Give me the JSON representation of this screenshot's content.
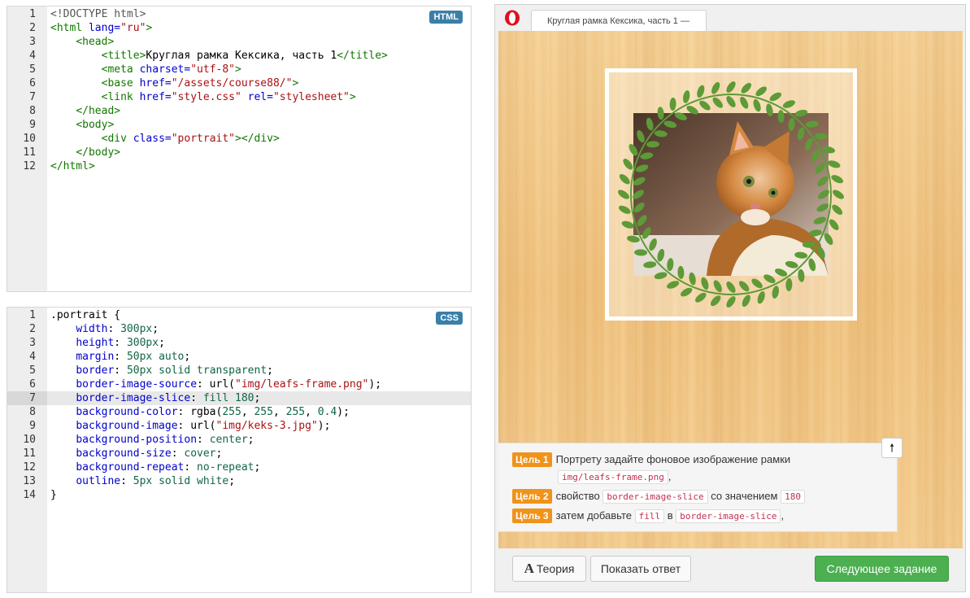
{
  "html_editor": {
    "badge": "HTML",
    "lines": [
      {
        "n": "1",
        "parts": [
          [
            "t-doct",
            "<!DOCTYPE html>"
          ]
        ]
      },
      {
        "n": "2",
        "parts": [
          [
            "t-tag",
            "<html "
          ],
          [
            "t-attr",
            "lang="
          ],
          [
            "t-str",
            "\"ru\""
          ],
          [
            "t-tag",
            ">"
          ]
        ]
      },
      {
        "n": "3",
        "parts": [
          [
            "t-txt",
            "    "
          ],
          [
            "t-tag",
            "<head>"
          ]
        ]
      },
      {
        "n": "4",
        "parts": [
          [
            "t-txt",
            "        "
          ],
          [
            "t-tag",
            "<title>"
          ],
          [
            "t-txt",
            "Круглая рамка Кексика, часть 1"
          ],
          [
            "t-tag",
            "</title>"
          ]
        ]
      },
      {
        "n": "5",
        "parts": [
          [
            "t-txt",
            "        "
          ],
          [
            "t-tag",
            "<meta "
          ],
          [
            "t-attr",
            "charset="
          ],
          [
            "t-str",
            "\"utf-8\""
          ],
          [
            "t-tag",
            ">"
          ]
        ]
      },
      {
        "n": "6",
        "parts": [
          [
            "t-txt",
            "        "
          ],
          [
            "t-tag",
            "<base "
          ],
          [
            "t-attr",
            "href="
          ],
          [
            "t-str",
            "\"/assets/course88/\""
          ],
          [
            "t-tag",
            ">"
          ]
        ]
      },
      {
        "n": "7",
        "parts": [
          [
            "t-txt",
            "        "
          ],
          [
            "t-tag",
            "<link "
          ],
          [
            "t-attr",
            "href="
          ],
          [
            "t-str",
            "\"style.css\""
          ],
          [
            "t-txt",
            " "
          ],
          [
            "t-attr",
            "rel="
          ],
          [
            "t-str",
            "\"stylesheet\""
          ],
          [
            "t-tag",
            ">"
          ]
        ]
      },
      {
        "n": "8",
        "parts": [
          [
            "t-txt",
            "    "
          ],
          [
            "t-tag",
            "</head>"
          ]
        ]
      },
      {
        "n": "9",
        "parts": [
          [
            "t-txt",
            "    "
          ],
          [
            "t-tag",
            "<body>"
          ]
        ]
      },
      {
        "n": "10",
        "parts": [
          [
            "t-txt",
            "        "
          ],
          [
            "t-tag",
            "<div "
          ],
          [
            "t-attr",
            "class="
          ],
          [
            "t-str",
            "\"portrait\""
          ],
          [
            "t-tag",
            "></div>"
          ]
        ]
      },
      {
        "n": "11",
        "parts": [
          [
            "t-txt",
            "    "
          ],
          [
            "t-tag",
            "</body>"
          ]
        ]
      },
      {
        "n": "12",
        "parts": [
          [
            "t-tag",
            "</html>"
          ]
        ]
      }
    ]
  },
  "css_editor": {
    "badge": "CSS",
    "active_line": "7",
    "lines": [
      {
        "n": "1",
        "parts": [
          [
            "t-txt",
            ".portrait {"
          ]
        ]
      },
      {
        "n": "2",
        "parts": [
          [
            "t-txt",
            "    "
          ],
          [
            "t-prop",
            "width"
          ],
          [
            "t-txt",
            ": "
          ],
          [
            "t-num",
            "300px"
          ],
          [
            "t-txt",
            ";"
          ]
        ]
      },
      {
        "n": "3",
        "parts": [
          [
            "t-txt",
            "    "
          ],
          [
            "t-prop",
            "height"
          ],
          [
            "t-txt",
            ": "
          ],
          [
            "t-num",
            "300px"
          ],
          [
            "t-txt",
            ";"
          ]
        ]
      },
      {
        "n": "4",
        "parts": [
          [
            "t-txt",
            "    "
          ],
          [
            "t-prop",
            "margin"
          ],
          [
            "t-txt",
            ": "
          ],
          [
            "t-num",
            "50px"
          ],
          [
            "t-txt",
            " "
          ],
          [
            "t-kw",
            "auto"
          ],
          [
            "t-txt",
            ";"
          ]
        ]
      },
      {
        "n": "5",
        "parts": [
          [
            "t-txt",
            "    "
          ],
          [
            "t-prop",
            "border"
          ],
          [
            "t-txt",
            ": "
          ],
          [
            "t-num",
            "50px"
          ],
          [
            "t-txt",
            " "
          ],
          [
            "t-kw",
            "solid"
          ],
          [
            "t-txt",
            " "
          ],
          [
            "t-kw",
            "transparent"
          ],
          [
            "t-txt",
            ";"
          ]
        ]
      },
      {
        "n": "6",
        "parts": [
          [
            "t-txt",
            "    "
          ],
          [
            "t-prop",
            "border-image-source"
          ],
          [
            "t-txt",
            ": url("
          ],
          [
            "t-str",
            "\"img/leafs-frame.png\""
          ],
          [
            "t-txt",
            ");"
          ]
        ]
      },
      {
        "n": "7",
        "parts": [
          [
            "t-txt",
            "    "
          ],
          [
            "t-prop",
            "border-image-slice"
          ],
          [
            "t-txt",
            ": "
          ],
          [
            "t-kw",
            "fill"
          ],
          [
            "t-txt",
            " "
          ],
          [
            "t-num",
            "180"
          ],
          [
            "t-txt",
            ";"
          ]
        ]
      },
      {
        "n": "8",
        "parts": [
          [
            "t-txt",
            "    "
          ],
          [
            "t-prop",
            "background-color"
          ],
          [
            "t-txt",
            ": rgba("
          ],
          [
            "t-num",
            "255"
          ],
          [
            "t-txt",
            ", "
          ],
          [
            "t-num",
            "255"
          ],
          [
            "t-txt",
            ", "
          ],
          [
            "t-num",
            "255"
          ],
          [
            "t-txt",
            ", "
          ],
          [
            "t-num",
            "0.4"
          ],
          [
            "t-txt",
            ");"
          ]
        ]
      },
      {
        "n": "9",
        "parts": [
          [
            "t-txt",
            "    "
          ],
          [
            "t-prop",
            "background-image"
          ],
          [
            "t-txt",
            ": url("
          ],
          [
            "t-str",
            "\"img/keks-3.jpg\""
          ],
          [
            "t-txt",
            ");"
          ]
        ]
      },
      {
        "n": "10",
        "parts": [
          [
            "t-txt",
            "    "
          ],
          [
            "t-prop",
            "background-position"
          ],
          [
            "t-txt",
            ": "
          ],
          [
            "t-kw",
            "center"
          ],
          [
            "t-txt",
            ";"
          ]
        ]
      },
      {
        "n": "11",
        "parts": [
          [
            "t-txt",
            "    "
          ],
          [
            "t-prop",
            "background-size"
          ],
          [
            "t-txt",
            ": "
          ],
          [
            "t-kw",
            "cover"
          ],
          [
            "t-txt",
            ";"
          ]
        ]
      },
      {
        "n": "12",
        "parts": [
          [
            "t-txt",
            "    "
          ],
          [
            "t-prop",
            "background-repeat"
          ],
          [
            "t-txt",
            ": "
          ],
          [
            "t-kw",
            "no-repeat"
          ],
          [
            "t-txt",
            ";"
          ]
        ]
      },
      {
        "n": "13",
        "parts": [
          [
            "t-txt",
            "    "
          ],
          [
            "t-prop",
            "outline"
          ],
          [
            "t-txt",
            ": "
          ],
          [
            "t-num",
            "5px"
          ],
          [
            "t-txt",
            " "
          ],
          [
            "t-kw",
            "solid"
          ],
          [
            "t-txt",
            " "
          ],
          [
            "t-kw",
            "white"
          ],
          [
            "t-txt",
            ";"
          ]
        ]
      },
      {
        "n": "14",
        "parts": [
          [
            "t-txt",
            "}"
          ]
        ]
      }
    ]
  },
  "browser": {
    "tab_title": "Круглая рамка Кексика, часть 1 —",
    "logo_icon": "opera-logo-icon"
  },
  "tasks": [
    {
      "label": "Цель 1",
      "text_before": "Портрету задайте фоновое изображение рамки",
      "code": "img/leafs-frame.png",
      "text_after": ","
    },
    {
      "label": "Цель 2",
      "text_before": "свойство",
      "code": "border-image-slice",
      "text_mid": "со значением",
      "code2": "180"
    },
    {
      "label": "Цель 3",
      "text_before": "затем добавьте",
      "code": "fill",
      "text_mid": "в",
      "code2": "border-image-slice",
      "text_after": ","
    }
  ],
  "buttons": {
    "theory_glyph": "A",
    "theory": "Теория",
    "show_answer": "Показать ответ",
    "next": "Следующее задание",
    "up_icon": "arrow-up-icon"
  },
  "colors": {
    "badge": "#3a7fa8",
    "goal": "#f0931a",
    "next_button": "#4caf50",
    "wreath_leaf": "#5e9a37"
  }
}
